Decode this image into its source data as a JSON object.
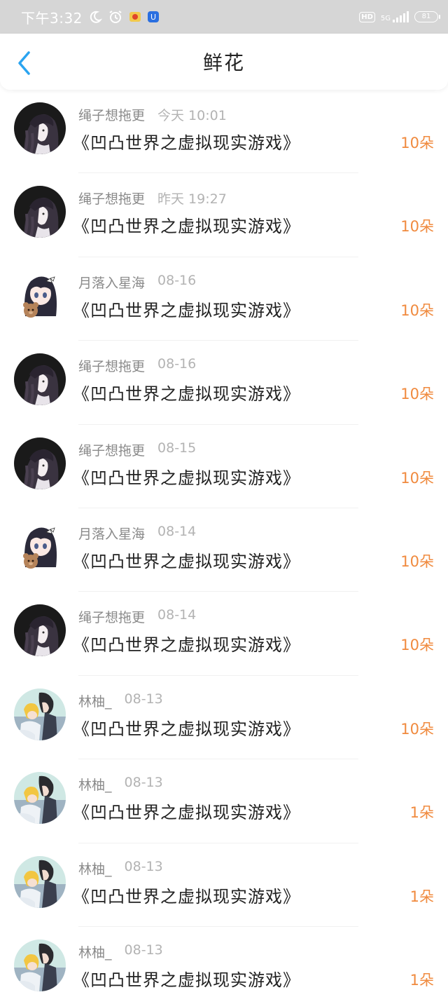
{
  "status_bar": {
    "time": "下午3:32",
    "hd": "HD",
    "network": "5G",
    "battery": "81"
  },
  "header": {
    "title": "鲜花"
  },
  "items": [
    {
      "user": "绳子想拖更",
      "time": "今天 10:01",
      "work": "《凹凸世界之虚拟现实游戏》",
      "amount": "10朵",
      "avatar": "dark-girl"
    },
    {
      "user": "绳子想拖更",
      "time": "昨天 19:27",
      "work": "《凹凸世界之虚拟现实游戏》",
      "amount": "10朵",
      "avatar": "dark-girl"
    },
    {
      "user": "月落入星海",
      "time": "08-16",
      "work": "《凹凸世界之虚拟现实游戏》",
      "amount": "10朵",
      "avatar": "anime-girl-bear"
    },
    {
      "user": "绳子想拖更",
      "time": "08-16",
      "work": "《凹凸世界之虚拟现实游戏》",
      "amount": "10朵",
      "avatar": "dark-girl"
    },
    {
      "user": "绳子想拖更",
      "time": "08-15",
      "work": "《凹凸世界之虚拟现实游戏》",
      "amount": "10朵",
      "avatar": "dark-girl"
    },
    {
      "user": "月落入星海",
      "time": "08-14",
      "work": "《凹凸世界之虚拟现实游戏》",
      "amount": "10朵",
      "avatar": "anime-girl-bear"
    },
    {
      "user": "绳子想拖更",
      "time": "08-14",
      "work": "《凹凸世界之虚拟现实游戏》",
      "amount": "10朵",
      "avatar": "dark-girl"
    },
    {
      "user": "林柚_",
      "time": "08-13",
      "work": "《凹凸世界之虚拟现实游戏》",
      "amount": "10朵",
      "avatar": "anime-pair"
    },
    {
      "user": "林柚_",
      "time": "08-13",
      "work": "《凹凸世界之虚拟现实游戏》",
      "amount": "1朵",
      "avatar": "anime-pair"
    },
    {
      "user": "林柚_",
      "time": "08-13",
      "work": "《凹凸世界之虚拟现实游戏》",
      "amount": "1朵",
      "avatar": "anime-pair"
    },
    {
      "user": "林柚_",
      "time": "08-13",
      "work": "《凹凸世界之虚拟现实游戏》",
      "amount": "1朵",
      "avatar": "anime-pair"
    }
  ],
  "colors": {
    "accent": "#2aa4f0",
    "amount": "#f08a3e",
    "status_bar_bg": "#d6d6d6"
  }
}
